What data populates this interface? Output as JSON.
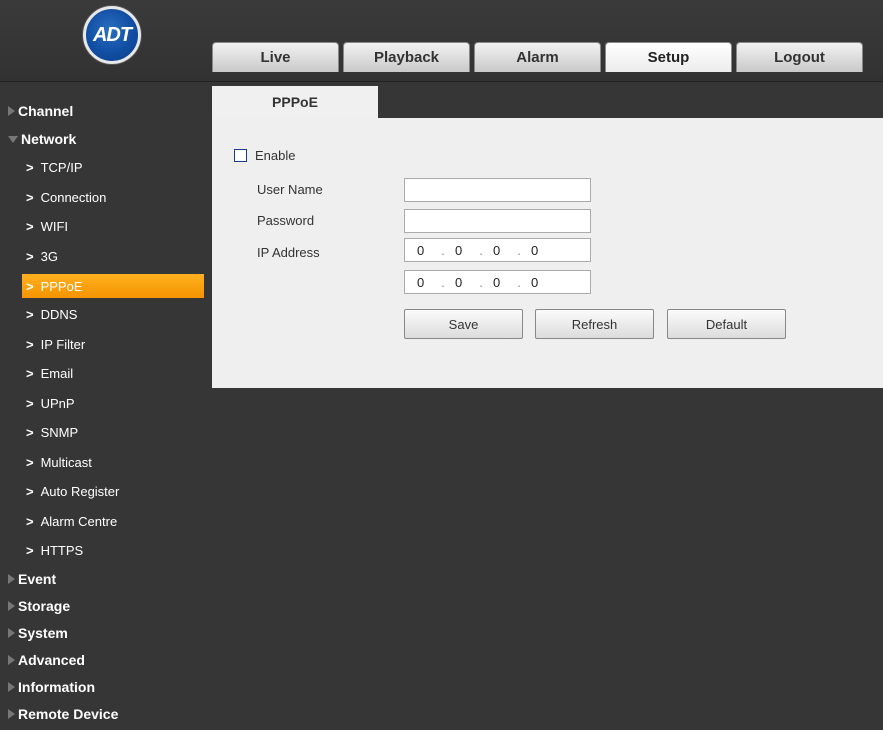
{
  "logo": {
    "text": "ADT"
  },
  "tabs": [
    "Live",
    "Playback",
    "Alarm",
    "Setup",
    "Logout"
  ],
  "active_tab": "Setup",
  "sidebar": {
    "groups_top": [
      {
        "label": "Channel",
        "open": false
      },
      {
        "label": "Network",
        "open": true
      }
    ],
    "network_items": [
      "TCP/IP",
      "Connection",
      "WIFI",
      "3G",
      "PPPoE",
      "DDNS",
      "IP Filter",
      "Email",
      "UPnP",
      "SNMP",
      "Multicast",
      "Auto Register",
      "Alarm Centre",
      "HTTPS"
    ],
    "active_item": "PPPoE",
    "groups_bottom": [
      "Event",
      "Storage",
      "System",
      "Advanced",
      "Information",
      "Remote Device"
    ]
  },
  "pane": {
    "tab_label": "PPPoE",
    "enable_label": "Enable",
    "enable_checked": false,
    "user_name_label": "User Name",
    "user_name_value": "",
    "password_label": "Password",
    "password_value": "",
    "ip_address_label": "IP Address",
    "ip1": [
      "0",
      "0",
      "0",
      "0"
    ],
    "ip2": [
      "0",
      "0",
      "0",
      "0"
    ],
    "buttons": {
      "save": "Save",
      "refresh": "Refresh",
      "default": "Default"
    }
  },
  "colors": {
    "accent": "#f59400",
    "background": "#363636",
    "panel": "#efefef"
  }
}
